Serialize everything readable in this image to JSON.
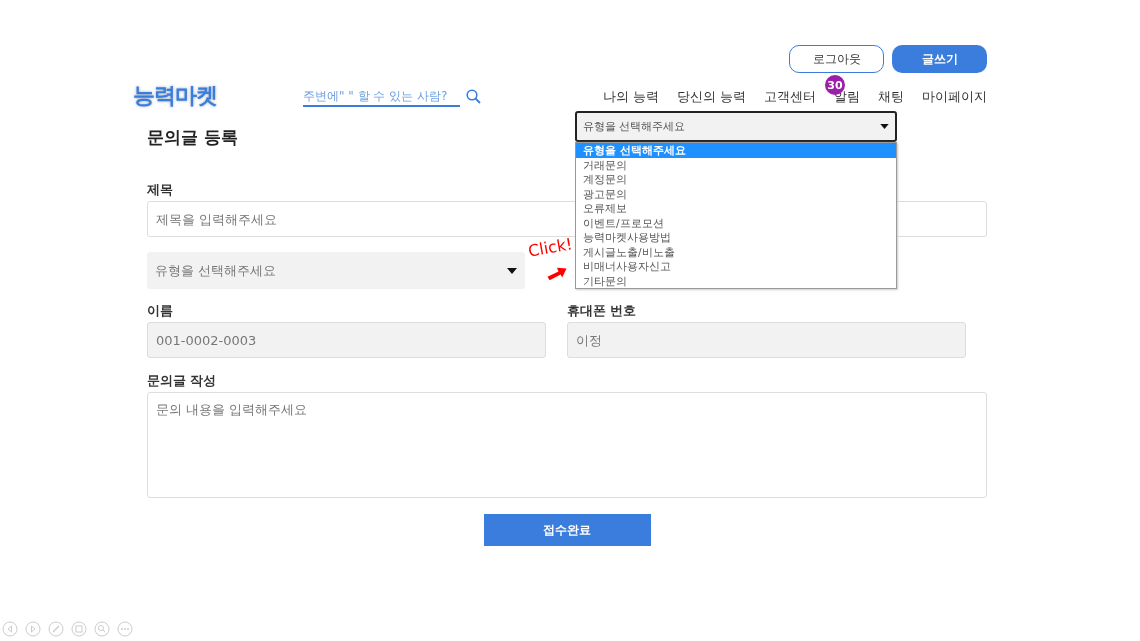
{
  "header_buttons": [
    {
      "label": "로그아웃",
      "kind": "outline"
    },
    {
      "label": "글쓰기",
      "kind": "primary"
    }
  ],
  "logo": "능력마켓",
  "search": {
    "placeholder": "주변에\" \" 할 수 있는 사람?"
  },
  "nav": [
    {
      "label": "나의 능력"
    },
    {
      "label": "당신의 능력"
    },
    {
      "label": "고객센터"
    },
    {
      "label": "알림",
      "badge": "30"
    },
    {
      "label": "채팅"
    },
    {
      "label": "마이페이지"
    }
  ],
  "page_title": "문의글 등록",
  "type_dropdown": {
    "value": "유형을 선택해주세요",
    "options": [
      {
        "label": "유형을 선택해주세요",
        "selected": true
      },
      {
        "label": "거래문의",
        "selected": false
      },
      {
        "label": "계정문의",
        "selected": false
      },
      {
        "label": "광고문의",
        "selected": false
      },
      {
        "label": "오류제보",
        "selected": false
      },
      {
        "label": "이벤트/프로모션",
        "selected": false
      },
      {
        "label": "능력마켓사용방법",
        "selected": false
      },
      {
        "label": "게시글노출/비노출",
        "selected": false
      },
      {
        "label": "비매너사용자신고",
        "selected": false
      },
      {
        "label": "기타문의",
        "selected": false
      }
    ]
  },
  "form": {
    "title_label": "제목",
    "title_placeholder": "제목을 입력해주세요",
    "category_placeholder": "유형을 선택해주세요",
    "name_label": "이름",
    "name_placeholder": "001-0002-0003",
    "phone_label": "휴대폰 번호",
    "phone_placeholder": "이정",
    "content_label": "문의글 작성",
    "content_placeholder": "문의 내용을 입력해주세요",
    "submit": "접수완료"
  },
  "annotation": "Click!"
}
